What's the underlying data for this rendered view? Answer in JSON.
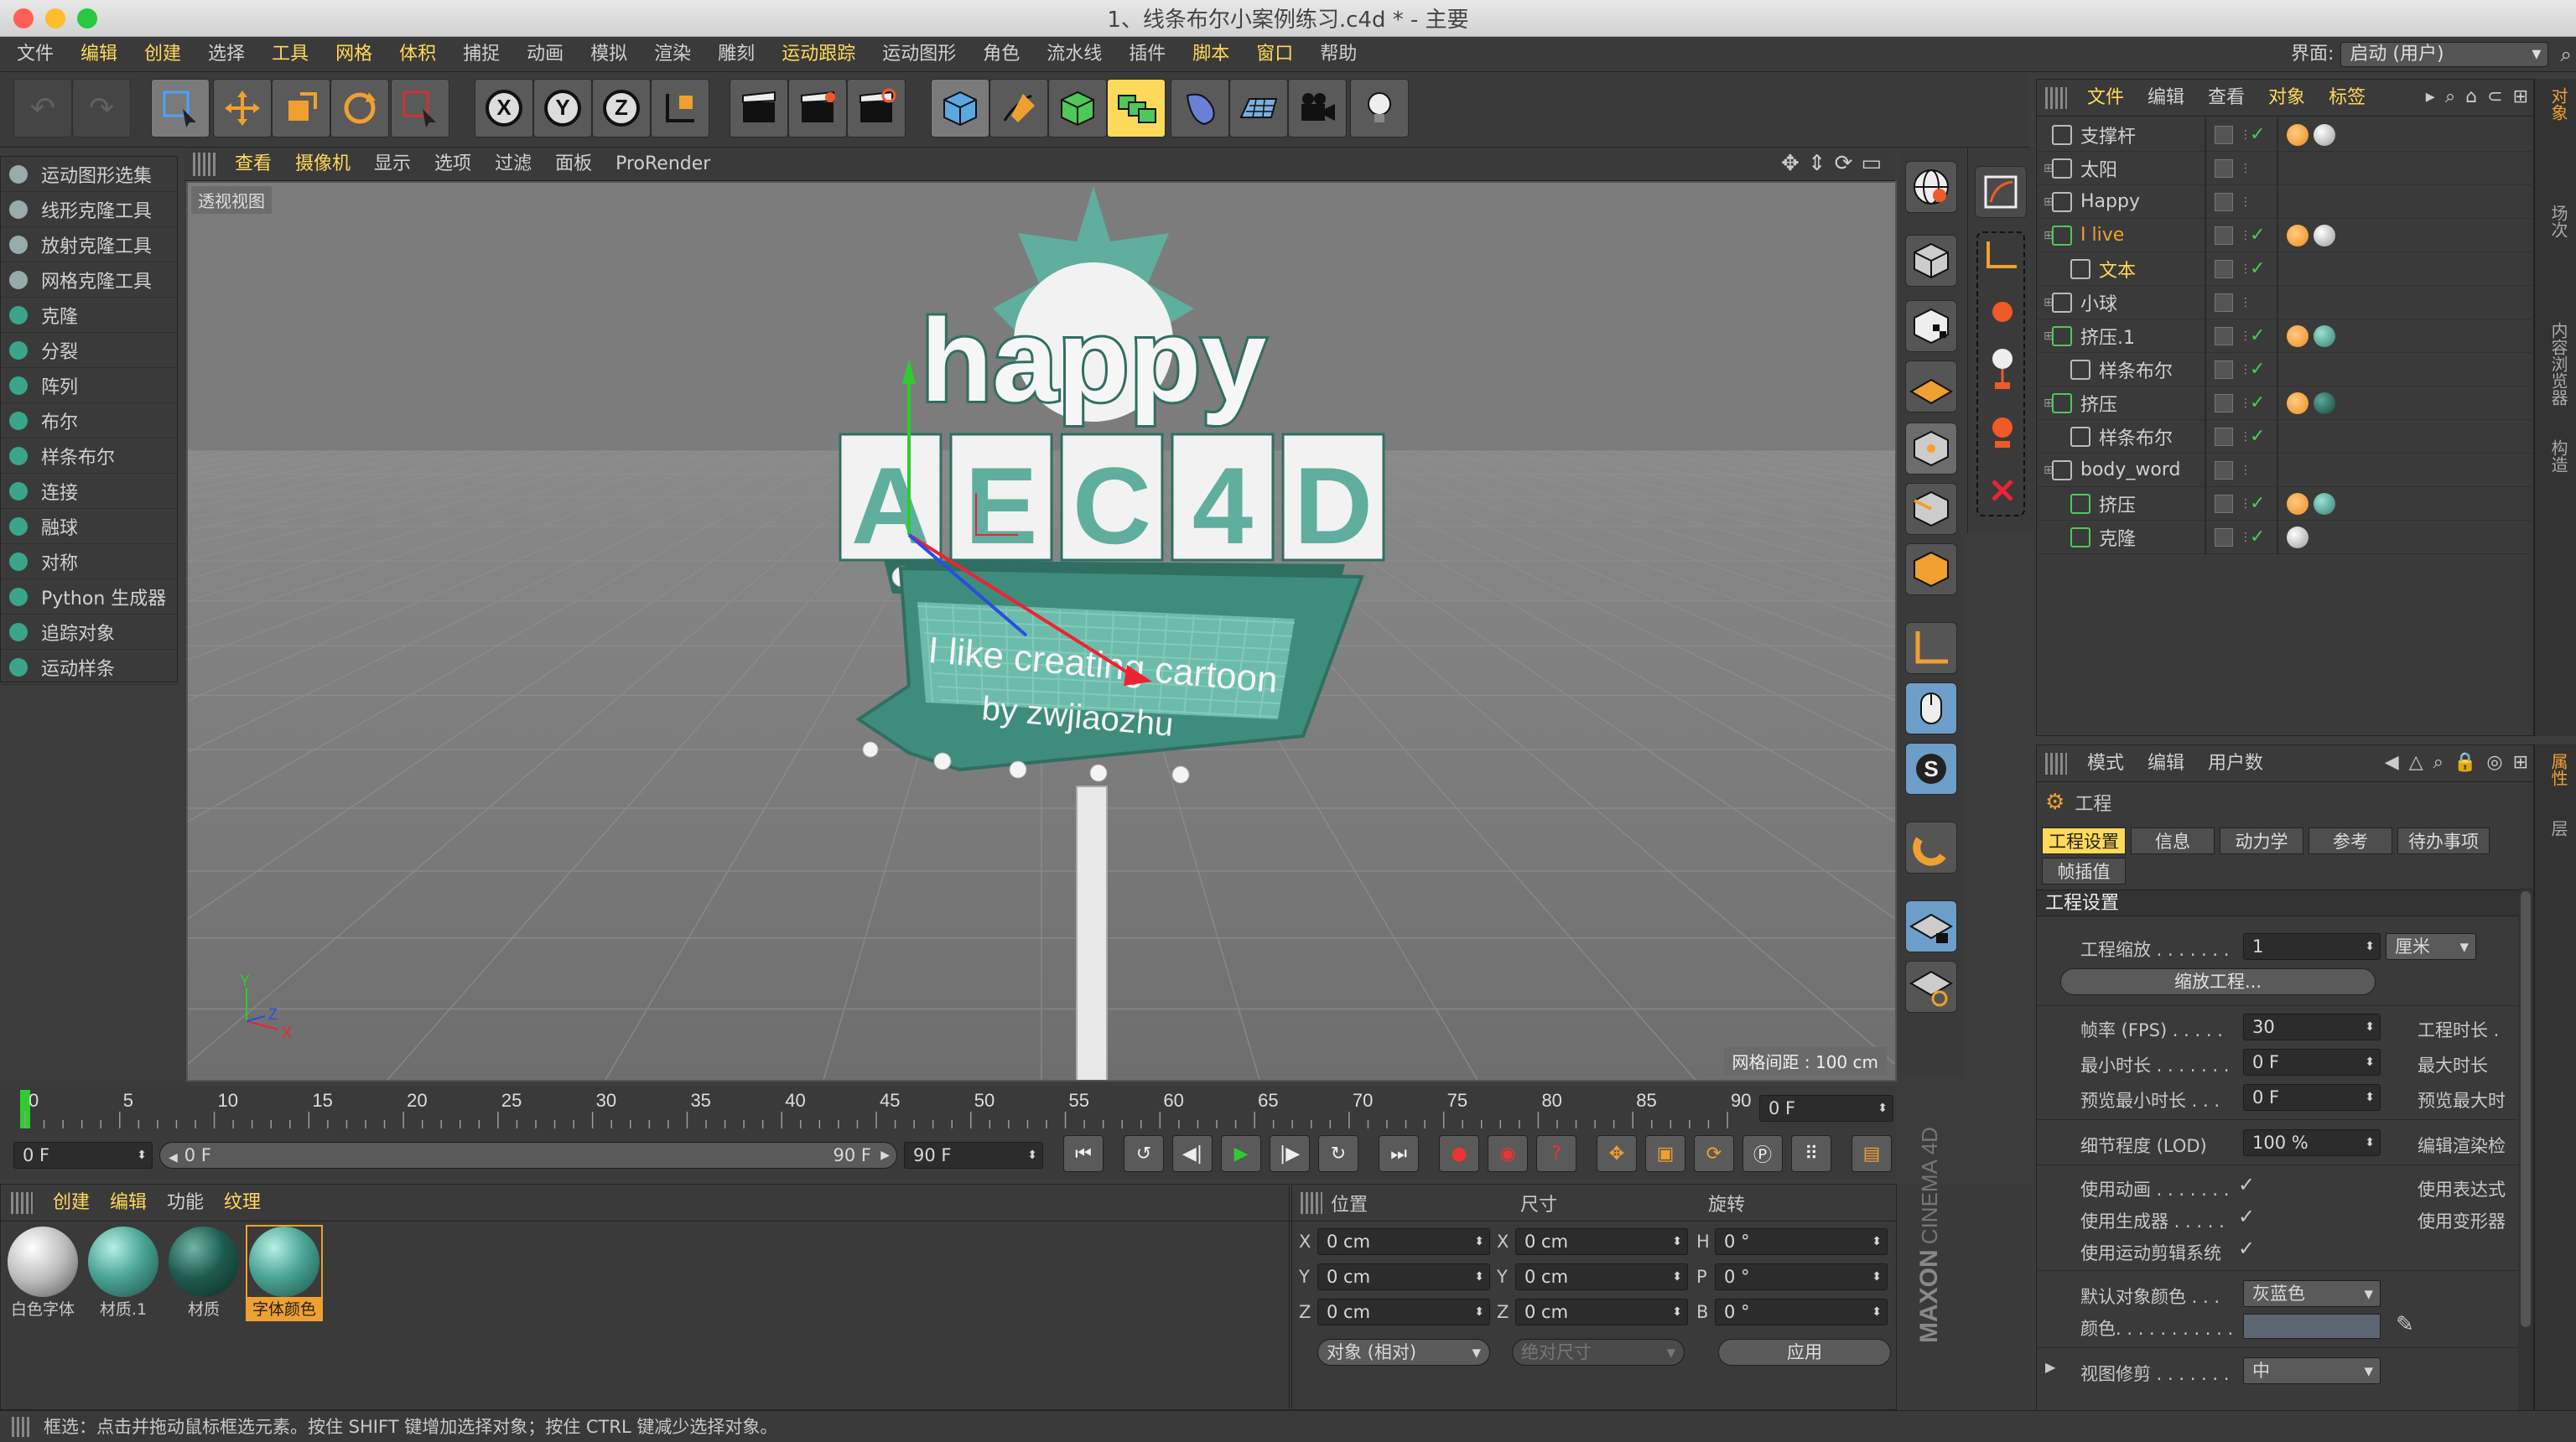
{
  "window": {
    "title": "1、线条布尔小案例练习.c4d * - 主要"
  },
  "menubar": {
    "items": [
      "文件",
      "编辑",
      "创建",
      "选择",
      "工具",
      "网格",
      "体积",
      "捕捉",
      "动画",
      "模拟",
      "渲染",
      "雕刻",
      "运动跟踪",
      "运动图形",
      "角色",
      "流水线",
      "插件",
      "脚本",
      "窗口",
      "帮助"
    ],
    "layout_label": "界面:",
    "layout_value": "启动 (用户)"
  },
  "toolbar": {
    "axes": [
      "X",
      "Y",
      "Z"
    ]
  },
  "left_tools": {
    "items": [
      {
        "label": "运动图形选集",
        "color": "#9aa"
      },
      {
        "label": "线形克隆工具",
        "color": "#9aa"
      },
      {
        "label": "放射克隆工具",
        "color": "#9aa"
      },
      {
        "label": "网格克隆工具",
        "color": "#9aa"
      },
      {
        "label": "克隆",
        "color": "#3aa58a"
      },
      {
        "label": "分裂",
        "color": "#3aa58a"
      },
      {
        "label": "阵列",
        "color": "#3aa58a"
      },
      {
        "label": "布尔",
        "color": "#3aa58a"
      },
      {
        "label": "样条布尔",
        "color": "#3aa58a"
      },
      {
        "label": "连接",
        "color": "#3aa58a"
      },
      {
        "label": "融球",
        "color": "#3aa58a"
      },
      {
        "label": "对称",
        "color": "#3aa58a"
      },
      {
        "label": "Python 生成器",
        "color": "#3aa58a"
      },
      {
        "label": "追踪对象",
        "color": "#3aa58a"
      },
      {
        "label": "运动样条",
        "color": "#3aa58a"
      }
    ]
  },
  "viewport": {
    "menu": [
      "查看",
      "摄像机",
      "显示",
      "选项",
      "过滤",
      "面板",
      "ProRender"
    ],
    "view_label": "透视视图",
    "grid_spacing": "网格间距 : 100 cm",
    "sign": {
      "word": "happy",
      "letters": [
        "A",
        "E",
        "C",
        "4",
        "D"
      ],
      "line1": "I like creating cartoon",
      "line2": "by zwjiaozhu"
    },
    "axis_labels": {
      "y": "Y",
      "z": "Z",
      "x": "X"
    }
  },
  "object_manager": {
    "menu": [
      "文件",
      "编辑",
      "查看",
      "对象",
      "标签"
    ],
    "rows": [
      {
        "name": "支撑杆",
        "indent": 0,
        "color": "#d0d0d0",
        "check": true,
        "tags": [
          "orange",
          "white"
        ]
      },
      {
        "name": "太阳",
        "indent": 0,
        "color": "#d0d0d0",
        "check": false,
        "tags": []
      },
      {
        "name": "Happy",
        "indent": 0,
        "color": "#d0d0d0",
        "check": false,
        "tags": []
      },
      {
        "name": "I live",
        "indent": 0,
        "color": "#f0a030",
        "check": true,
        "tags": [
          "orange",
          "white"
        ]
      },
      {
        "name": "文本",
        "indent": 1,
        "color": "#ffd95a",
        "check": true,
        "tags": []
      },
      {
        "name": "小球",
        "indent": 0,
        "color": "#d0d0d0",
        "check": false,
        "tags": []
      },
      {
        "name": "挤压.1",
        "indent": 0,
        "color": "#d0d0d0",
        "check": true,
        "tags": [
          "orange",
          "teal"
        ]
      },
      {
        "name": "样条布尔",
        "indent": 1,
        "color": "#d0d0d0",
        "check": true,
        "tags": []
      },
      {
        "name": "挤压",
        "indent": 0,
        "color": "#d0d0d0",
        "check": true,
        "tags": [
          "orange",
          "darkteal"
        ]
      },
      {
        "name": "样条布尔",
        "indent": 1,
        "color": "#d0d0d0",
        "check": true,
        "tags": []
      },
      {
        "name": "body_word",
        "indent": 0,
        "color": "#d0d0d0",
        "check": false,
        "tags": []
      },
      {
        "name": "挤压",
        "indent": 1,
        "color": "#d0d0d0",
        "check": true,
        "tags": [
          "orange",
          "teal"
        ]
      },
      {
        "name": "克隆",
        "indent": 1,
        "color": "#d0d0d0",
        "check": true,
        "tags": [
          "white"
        ]
      }
    ],
    "side_tabs": [
      "对象",
      "场次",
      "内容浏览器",
      "构造"
    ]
  },
  "attributes": {
    "menu": [
      "模式",
      "编辑",
      "用户数"
    ],
    "title": "工程",
    "tabs": [
      "工程设置",
      "信息",
      "动力学",
      "参考",
      "待办事项"
    ],
    "tab2": "帧插值",
    "section": "工程设置",
    "scale_label": "工程缩放 . . . . . . .",
    "scale_value": "1",
    "scale_unit": "厘米",
    "scale_button": "缩放工程...",
    "fps_label": "帧率 (FPS) . . . . .",
    "fps_value": "30",
    "project_len": "工程时长 .",
    "min_len_label": "最小时长 . . . . . . .",
    "min_len_value": "0 F",
    "max_len": "最大时长",
    "preview_min_label": "预览最小时长 . . .",
    "preview_min_value": "0 F",
    "preview_max": "预览最大时",
    "lod_label": "细节程度 (LOD)",
    "lod_value": "100 %",
    "edit_render": "编辑渲染检",
    "use_anim": "使用动画 . . . . . . .",
    "use_expr": "使用表达式",
    "use_gen": "使用生成器 . . . . .",
    "use_deform": "使用变形器",
    "use_motion": "使用运动剪辑系统",
    "default_color_label": "默认对象颜色 . . .",
    "default_color_value": "灰蓝色",
    "color_label": "颜色. . . . . . . . . . .",
    "view_clip_label": "视图修剪 . . . . . . .",
    "view_clip_value": "中",
    "side_tabs": [
      "属性",
      "层"
    ]
  },
  "timeline": {
    "ticks": [
      "0",
      "5",
      "10",
      "15",
      "20",
      "25",
      "30",
      "35",
      "40",
      "45",
      "50",
      "55",
      "60",
      "65",
      "70",
      "75",
      "80",
      "85",
      "90"
    ],
    "current_frame": "0 F",
    "start": "0 F",
    "range_start": "0 F",
    "range_end": "90 F",
    "end": "90 F"
  },
  "materials": {
    "menu": [
      "创建",
      "编辑",
      "功能",
      "纹理"
    ],
    "items": [
      {
        "name": "白色字体",
        "kind": "white"
      },
      {
        "name": "材质.1",
        "kind": "teal"
      },
      {
        "name": "材质",
        "kind": "darkteal"
      },
      {
        "name": "字体颜色",
        "kind": "teal",
        "selected": true
      }
    ]
  },
  "coords": {
    "headers": [
      "位置",
      "尺寸",
      "旋转"
    ],
    "rows": [
      {
        "a": "X",
        "av": "0 cm",
        "b": "X",
        "bv": "0 cm",
        "c": "H",
        "cv": "0 °"
      },
      {
        "a": "Y",
        "av": "0 cm",
        "b": "Y",
        "bv": "0 cm",
        "c": "P",
        "cv": "0 °"
      },
      {
        "a": "Z",
        "av": "0 cm",
        "b": "Z",
        "bv": "0 cm",
        "c": "B",
        "cv": "0 °"
      }
    ],
    "mode": "对象 (相对)",
    "size_mode": "绝对尺寸",
    "apply": "应用",
    "brand1": "MAXON",
    "brand2": "CINEMA 4D"
  },
  "status": "框选：点击并拖动鼠标框选元素。按住 SHIFT 键增加选择对象；按住 CTRL 键减少选择对象。",
  "colors": {
    "teal": "#5fae9e",
    "dark_teal": "#2f6f62",
    "highlight": "#ffd95a",
    "orange": "#f0a030"
  }
}
